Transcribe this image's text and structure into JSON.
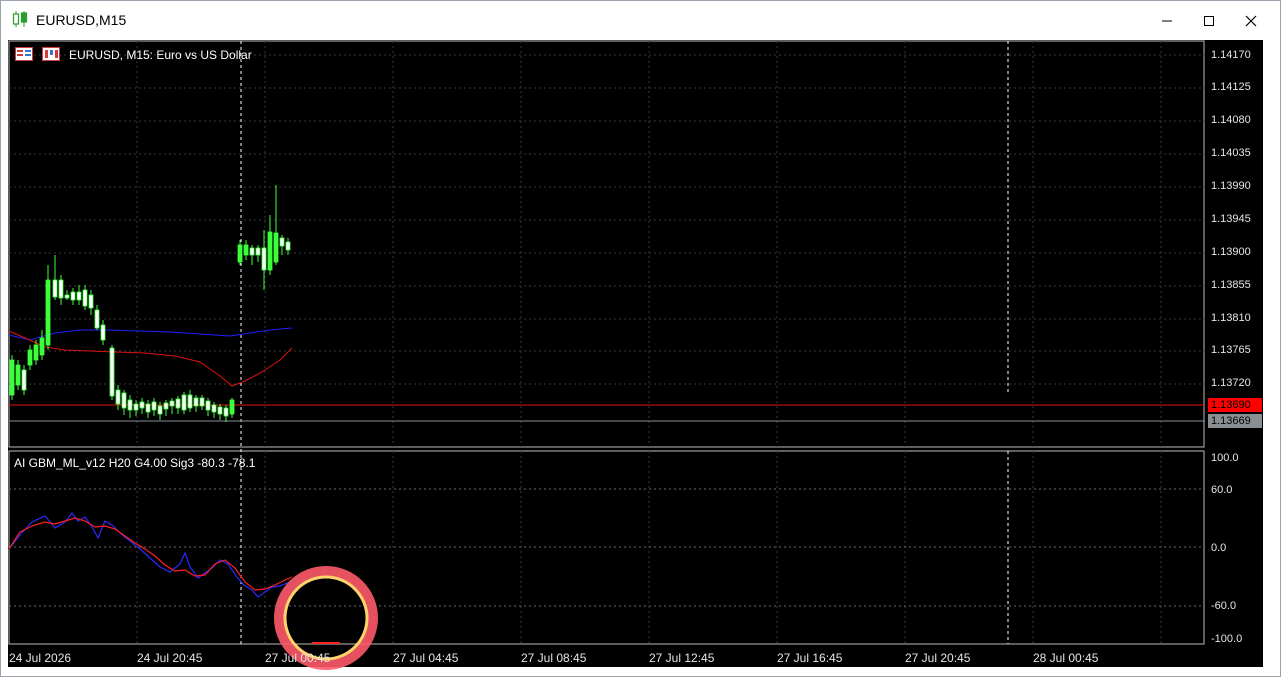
{
  "window": {
    "title": "EURUSD,M15",
    "controls": {
      "minimize": "minimize-icon",
      "maximize": "maximize-icon",
      "close": "close-icon"
    }
  },
  "chart": {
    "header": "EURUSD, M15:  Euro vs US Dollar",
    "price_axis": [
      "1.14170",
      "1.14125",
      "1.14080",
      "1.14035",
      "1.13990",
      "1.13945",
      "1.13900",
      "1.13855",
      "1.13810",
      "1.13765",
      "1.13720"
    ],
    "bid_badge": {
      "text": "1.13690",
      "color": "#ff0000"
    },
    "ask_badge": {
      "text": "1.13669",
      "color": "#8a8f94"
    },
    "time_axis": [
      "24 Jul 2026",
      "24 Jul 20:45",
      "27 Jul 00:45",
      "27 Jul 04:45",
      "27 Jul 08:45",
      "27 Jul 12:45",
      "27 Jul 16:45",
      "27 Jul 20:45",
      "28 Jul 00:45"
    ],
    "colors": {
      "bull": "#3cff3c",
      "ma_blue": "#1f1fff",
      "ma_red": "#e01010",
      "grid": "#3a3a3a"
    }
  },
  "indicator": {
    "label": "AI GBM_ML_v12 H20 G4.00 Sig3 -80.3 -78.1",
    "axis": [
      "100.0",
      "60.0",
      "0.0",
      "-60.0",
      "-100.0"
    ],
    "colors": {
      "line_blue": "#2a2aff",
      "line_red": "#ff2020"
    }
  },
  "cursor_highlight": {
    "color_outer": "#ff5a6a",
    "color_inner": "#ffd36a"
  }
}
